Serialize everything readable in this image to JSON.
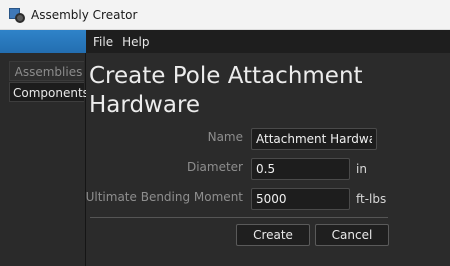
{
  "window": {
    "title": "Assembly Creator"
  },
  "menu": {
    "file": "File",
    "help": "Help"
  },
  "sidebar": {
    "items": [
      {
        "label": "Assemblies"
      },
      {
        "label": "Components"
      }
    ]
  },
  "form": {
    "title": "Create Pole Attachment Hardware",
    "fields": [
      {
        "label": "Name",
        "value": "Attachment Hardware",
        "unit": ""
      },
      {
        "label": "Diameter",
        "value": "0.5",
        "unit": "in"
      },
      {
        "label": "Ultimate Bending Moment",
        "value": "5000",
        "unit": "ft-lbs"
      }
    ],
    "create_label": "Create",
    "cancel_label": "Cancel"
  },
  "colors": {
    "accent": "#2f83c9",
    "background": "#2b2b2b"
  }
}
